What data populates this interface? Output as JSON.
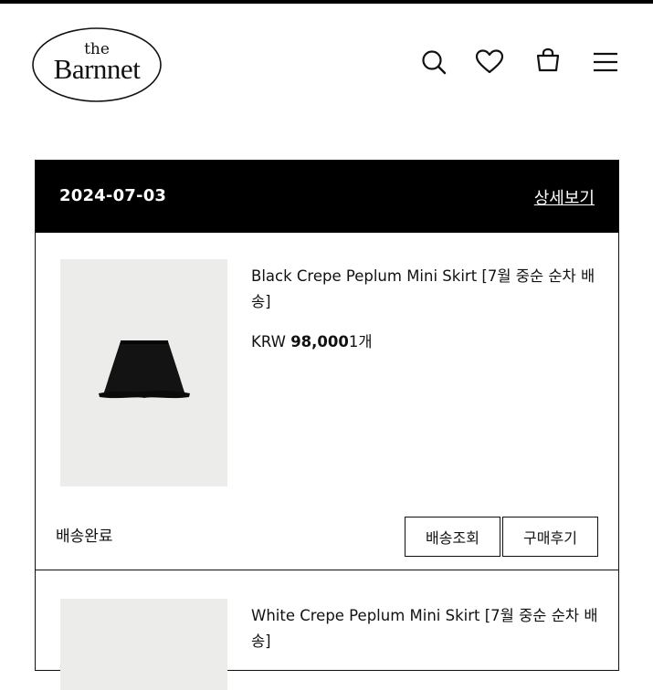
{
  "brand": {
    "logo_top": "the",
    "logo_name": "Barnnet"
  },
  "header_icons": [
    "search-icon",
    "heart-icon",
    "shopping-bag-icon",
    "menu-icon"
  ],
  "order": {
    "date": "2024-07-03",
    "detail_link": "상세보기",
    "items": [
      {
        "name": "Black Crepe Peplum Mini Skirt [7월 중순 순차 배송]",
        "currency": "KRW",
        "price": "98,000",
        "quantity": "1개",
        "status": "배송완료",
        "track_button": "배송조회",
        "review_button": "구매후기"
      },
      {
        "name": "White Crepe Peplum Mini Skirt [7월 중순 순차 배송]"
      }
    ]
  },
  "colors": {
    "header_bg": "#000000",
    "thumb_bg": "#ececeb",
    "text": "#111111"
  }
}
